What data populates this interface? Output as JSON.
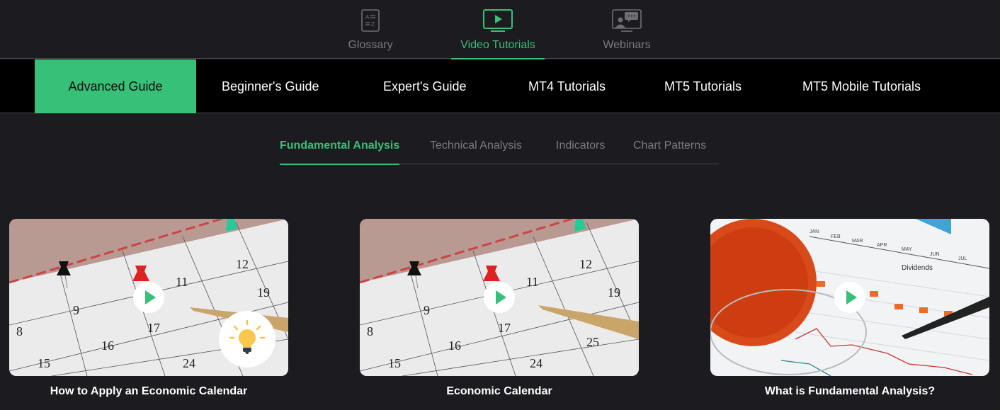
{
  "top_nav": {
    "items": [
      {
        "label": "Glossary",
        "icon": "glossary-az-icon",
        "active": false
      },
      {
        "label": "Video Tutorials",
        "icon": "video-monitor-icon",
        "active": true
      },
      {
        "label": "Webinars",
        "icon": "webinar-presenter-icon",
        "active": false
      }
    ]
  },
  "categories": [
    {
      "label": "Advanced Guide",
      "active": true
    },
    {
      "label": "Beginner's Guide",
      "active": false
    },
    {
      "label": "Expert's Guide",
      "active": false
    },
    {
      "label": "MT4 Tutorials",
      "active": false
    },
    {
      "label": "MT5 Tutorials",
      "active": false
    },
    {
      "label": "MT5 Mobile Tutorials",
      "active": false
    }
  ],
  "sub_tabs": [
    {
      "label": "Fundamental Analysis",
      "active": true
    },
    {
      "label": "Technical Analysis",
      "active": false
    },
    {
      "label": "Indicators",
      "active": false
    },
    {
      "label": "Chart Patterns",
      "active": false
    }
  ],
  "videos": [
    {
      "title": "How to Apply an Economic Calendar",
      "thumbnail": "calendar-pins-with-lightbulb",
      "badge_icon": "lightbulb-icon"
    },
    {
      "title": "Economic Calendar",
      "thumbnail": "calendar-pins"
    },
    {
      "title": "What is Fundamental Analysis?",
      "thumbnail": "tea-cup-dividends-chart"
    }
  ],
  "colors": {
    "accent": "#37c077",
    "background": "#1c1b1f",
    "category_bar": "#000000",
    "muted_text": "#7a7a7e"
  }
}
